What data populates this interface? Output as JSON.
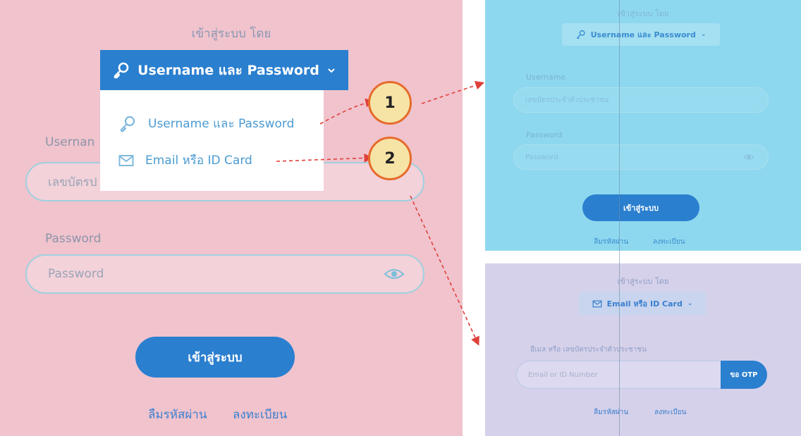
{
  "left_panel": {
    "heading": "เข้าสู่ระบบ โดย",
    "method_button": "Username และ Password",
    "menu_items": [
      "Username และ Password",
      "Email หรือ ID Card"
    ],
    "username_label": "Usernan",
    "username_placeholder": "เลขบัตรป",
    "password_label": "Password",
    "password_placeholder": "Password",
    "login_button": "เข้าสู่ระบบ",
    "forgot_password": "ลืมรหัสผ่าน",
    "register": "ลงทะเบียน"
  },
  "callouts": [
    "1",
    "2"
  ],
  "right_top": {
    "heading": "เข้าสู่ระบบ โดย",
    "method_button": "Username และ Password",
    "username_label": "Username",
    "username_placeholder": "เลขบัตรประจำตัวประชาชน",
    "password_label": "Password",
    "password_placeholder": "Password",
    "login_button": "เข้าสู่ระบบ",
    "forgot_password": "ลืมรหัสผ่าน",
    "register": "ลงทะเบียน"
  },
  "right_bottom": {
    "heading": "เข้าสู่ระบบ โดย",
    "method_button": "Email หรือ ID Card",
    "field_label": "อีเมล หรือ เลขบัตรประจำตัวประชาชน",
    "email_placeholder": "Email or ID Number",
    "otp_button": "ขอ OTP",
    "forgot_password": "ลืมรหัสผ่าน",
    "register": "ลงทะเบียน"
  },
  "colors": {
    "left_bg": "#f0c3cd",
    "right_top_bg": "#8ed8ef",
    "right_bottom_bg": "#d6d1ea",
    "primary": "#2a7fcf",
    "callout_fill": "#f6e3a6",
    "callout_border": "#e66b2b",
    "arrow": "#e0403a"
  }
}
